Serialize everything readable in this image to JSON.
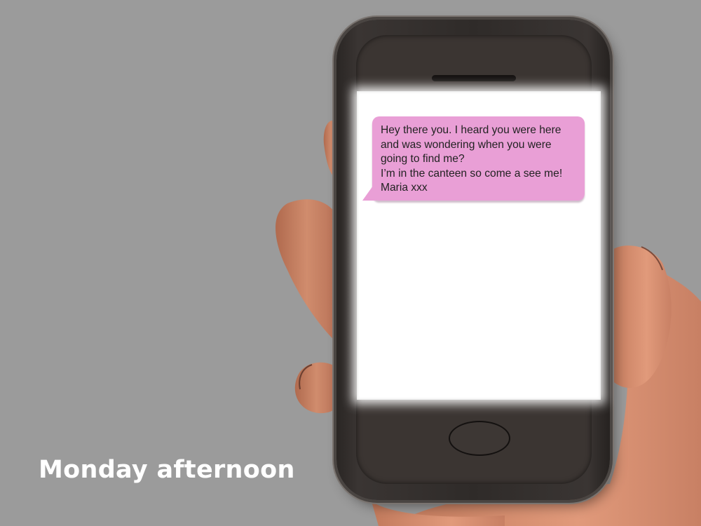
{
  "message": {
    "lines": [
      "Hey there you. I heard you were here",
      "and was wondering when you were",
      "going to find me?",
      "I’m in the canteen so come a see me!",
      "Maria xxx"
    ]
  },
  "caption": "Monday afternoon",
  "colors": {
    "background": "#9b9b9b",
    "bubble": "#e99fd6",
    "phone_body": "#2f2b29",
    "skin": "#c98466"
  }
}
